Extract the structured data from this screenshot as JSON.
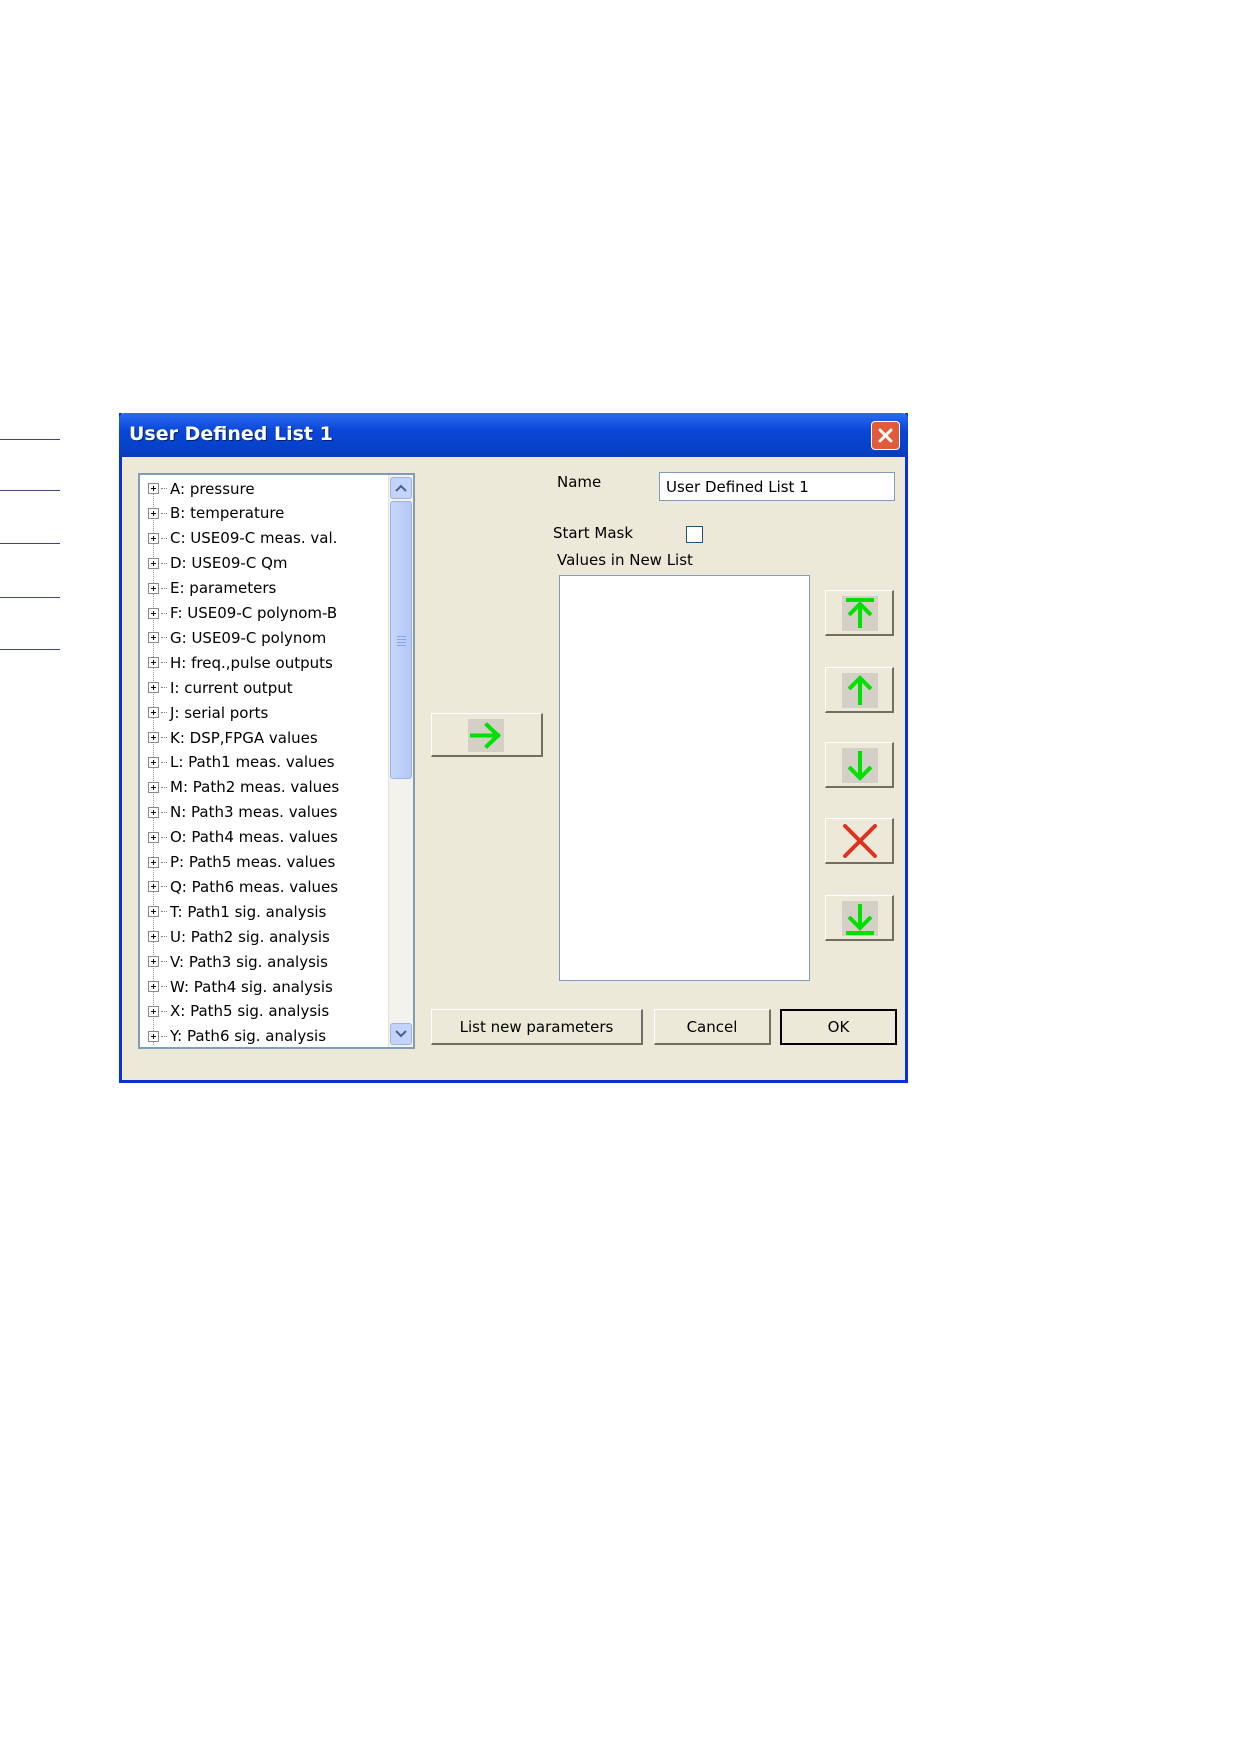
{
  "dialog": {
    "title": "User Defined List 1"
  },
  "tree": {
    "items": [
      "A: pressure",
      "B: temperature",
      "C: USE09-C meas. val.",
      "D: USE09-C Qm",
      "E: parameters",
      "F: USE09-C polynom-B",
      "G: USE09-C polynom",
      "H: freq.,pulse outputs",
      "I: current output",
      "J: serial ports",
      "K: DSP,FPGA values",
      "L: Path1 meas. values",
      "M: Path2 meas. values",
      "N: Path3 meas. values",
      "O: Path4 meas. values",
      "P: Path5 meas. values",
      "Q: Path6 meas. values",
      "T: Path1 sig. analysis",
      "U: Path2 sig. analysis",
      "V: Path3 sig. analysis",
      "W: Path4 sig. analysis",
      "X: Path5 sig. analysis",
      "Y: Path6 sig. analysis"
    ]
  },
  "form": {
    "name_label": "Name",
    "name_value": "User Defined List 1",
    "start_mask_label": "Start Mask",
    "start_mask_checked": false,
    "values_label": "Values in New List",
    "values": []
  },
  "buttons": {
    "list_new": "List new parameters",
    "cancel": "Cancel",
    "ok": "OK"
  },
  "icons": {
    "add": "arrow-right-icon",
    "move_top": "arrow-up-to-top-icon",
    "move_up": "arrow-up-icon",
    "move_down": "arrow-down-icon",
    "delete": "delete-x-icon",
    "move_bottom": "arrow-down-to-bottom-icon"
  },
  "colors": {
    "titlebar": "#0a46d8",
    "dialog_bg": "#ece9d8",
    "arrow_green": "#00e000",
    "delete_red": "#e03020",
    "close_red": "#e15a3a"
  }
}
